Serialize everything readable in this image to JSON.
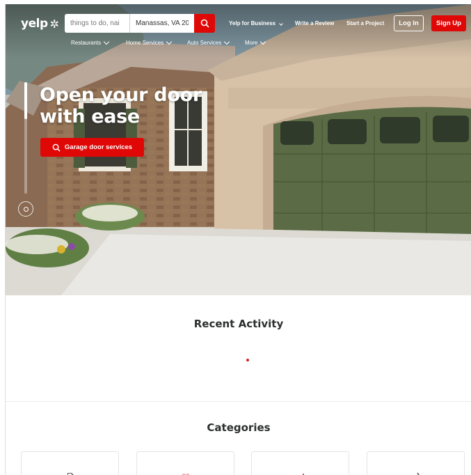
{
  "header": {
    "logo": "yelp",
    "search_find_placeholder": "things to do, nai",
    "search_near_value": "Manassas, VA 20",
    "nav_links": [
      "Yelp for Business",
      "Write a Review",
      "Start a Project"
    ],
    "login_label": "Log In",
    "signup_label": "Sign Up"
  },
  "category_nav": [
    "Restaurants",
    "Home Services",
    "Auto Services",
    "More"
  ],
  "hero": {
    "headline_line1": "Open your door",
    "headline_line2": "with ease",
    "cta_label": "Garage door services",
    "carousel_progress": 0.33
  },
  "recent_activity": {
    "title": "Recent Activity"
  },
  "categories": {
    "title": "Categories",
    "cards": [
      "gas-pump-icon",
      "heart-icon",
      "sparkle-icon",
      "tools-icon"
    ]
  },
  "colors": {
    "brand_red": "#e00707",
    "text_dark": "#2d2e2f",
    "door_green": "#5a6b45"
  }
}
